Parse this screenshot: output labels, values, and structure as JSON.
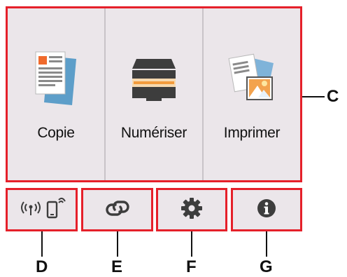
{
  "tiles": [
    {
      "label": "Copie",
      "icon": "copy-icon"
    },
    {
      "label": "Numériser",
      "icon": "scanner-icon"
    },
    {
      "label": "Imprimer",
      "icon": "print-photo-icon"
    }
  ],
  "bottom_buttons": [
    {
      "icon": "wireless-status-icon"
    },
    {
      "icon": "link-icon"
    },
    {
      "icon": "gear-icon"
    },
    {
      "icon": "info-icon"
    }
  ],
  "callouts": {
    "c": "C",
    "d": "D",
    "e": "E",
    "f": "F",
    "g": "G"
  },
  "colors": {
    "highlight": "#e5202a",
    "panel": "#ebe6ea",
    "icon_dark": "#3d3d3d"
  }
}
